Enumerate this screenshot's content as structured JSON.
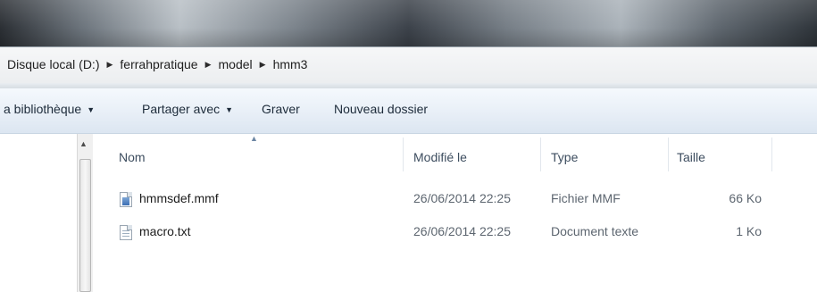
{
  "address": {
    "crumbs": [
      "Disque local (D:)",
      "ferrahpratique",
      "model",
      "hmm3"
    ]
  },
  "toolbar": {
    "library": "a bibliothèque",
    "share": "Partager avec",
    "burn": "Graver",
    "new_folder": "Nouveau dossier"
  },
  "columns": {
    "name": "Nom",
    "modified": "Modifié le",
    "type": "Type",
    "size": "Taille"
  },
  "files": [
    {
      "name": "hmmsdef.mmf",
      "modified": "26/06/2014 22:25",
      "type": "Fichier MMF",
      "size": "66 Ko",
      "icon": "mmf-file-icon"
    },
    {
      "name": "macro.txt",
      "modified": "26/06/2014 22:25",
      "type": "Document texte",
      "size": "1 Ko",
      "icon": "text-file-icon"
    }
  ],
  "colors": {
    "toolbar_bg": "#e8eff7",
    "header_text": "#3d4d5f",
    "detail_text": "#5d6670"
  }
}
